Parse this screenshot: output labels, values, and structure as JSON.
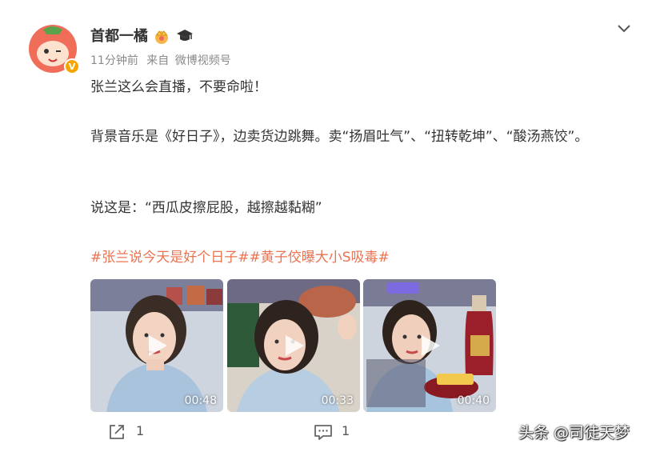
{
  "post": {
    "author": "首都一橘",
    "time": "11分钟前",
    "source_prefix": "来自",
    "source": "微博视频号",
    "line1": "张兰这么会直播，不要命啦！",
    "line2": "背景音乐是《好日子》，边卖货边跳舞。卖“扬眉吐气”、“扭转乾坤”、“酸汤燕饺”。",
    "line3": "说这是：“西瓜皮擦屁股，越擦越黏糊”",
    "tags": [
      "#张兰说今天是好个日子#",
      "#黄子佼曝大小S吸毒#"
    ],
    "tag_color": "#eb7350"
  },
  "videos": [
    {
      "duration": "00:48"
    },
    {
      "duration": "00:33"
    },
    {
      "duration": "00:40"
    }
  ],
  "actions": {
    "share_count": "1",
    "comment_count": "1"
  },
  "watermark": "头条 @司徒天梦",
  "icons": [
    "avatar",
    "crown-icon",
    "graduation-cap-icon",
    "chevron-down-icon",
    "play-icon",
    "share-icon",
    "comment-icon"
  ]
}
